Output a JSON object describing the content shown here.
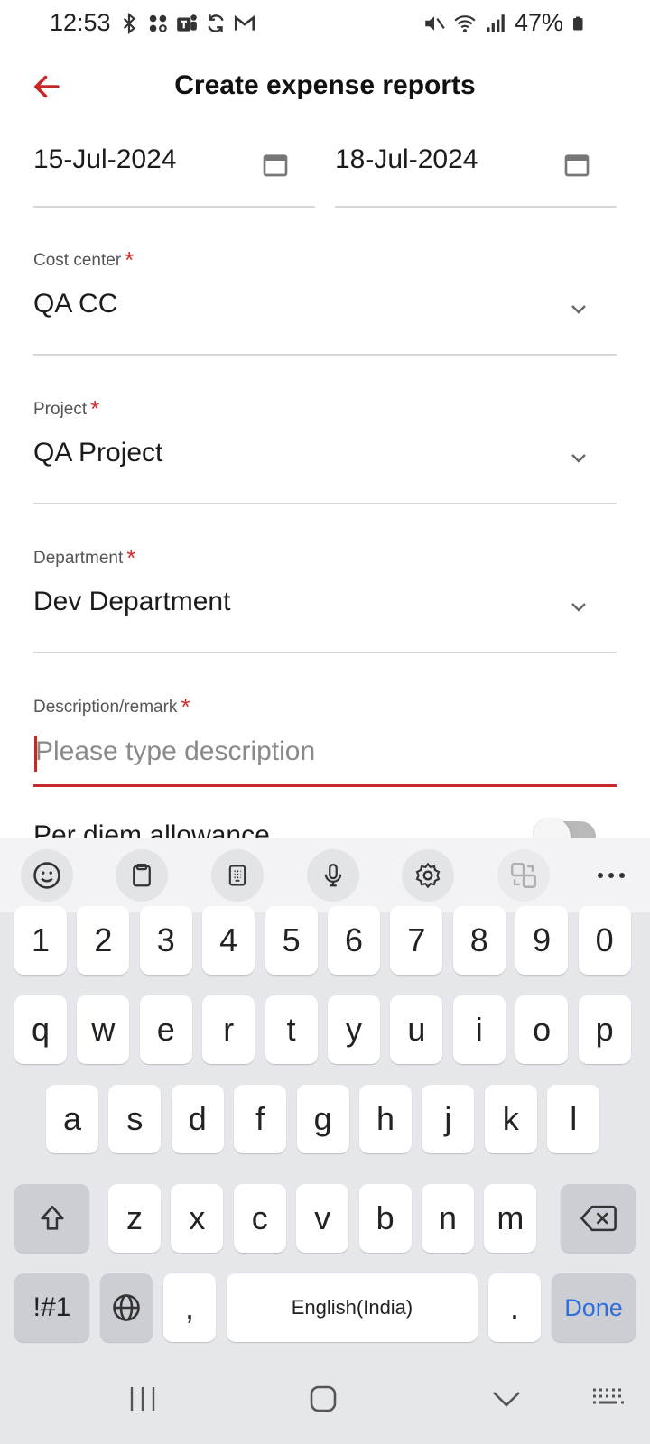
{
  "status_bar": {
    "time": "12:53",
    "battery": "47%",
    "left_icons": [
      "bluetooth-icon",
      "app-grid-icon",
      "teams-icon",
      "sync-icon",
      "gmail-icon"
    ],
    "right_icons": [
      "mute-icon",
      "wifi-icon",
      "signal-icon",
      "battery-icon"
    ]
  },
  "header": {
    "title": "Create expense reports"
  },
  "dates": {
    "start": "15-Jul-2024",
    "end": "18-Jul-2024"
  },
  "form": {
    "cost_center": {
      "label": "Cost center",
      "required": "*",
      "value": "QA CC"
    },
    "project": {
      "label": "Project",
      "required": "*",
      "value": "QA Project"
    },
    "department": {
      "label": "Department",
      "required": "*",
      "value": "Dev Department"
    },
    "description": {
      "label": "Description/remark",
      "required": "*",
      "placeholder": "Please type description",
      "value": ""
    },
    "per_diem": {
      "label": "Per diem allowance",
      "enabled": false
    }
  },
  "keyboard": {
    "toolbar": [
      "emoji-icon",
      "clipboard-icon",
      "keypad-icon",
      "mic-icon",
      "settings-icon",
      "translate-icon",
      "more-icon"
    ],
    "row_numbers": [
      "1",
      "2",
      "3",
      "4",
      "5",
      "6",
      "7",
      "8",
      "9",
      "0"
    ],
    "row1": [
      "q",
      "w",
      "e",
      "r",
      "t",
      "y",
      "u",
      "i",
      "o",
      "p"
    ],
    "row2": [
      "a",
      "s",
      "d",
      "f",
      "g",
      "h",
      "j",
      "k",
      "l"
    ],
    "row3": [
      "z",
      "x",
      "c",
      "v",
      "b",
      "n",
      "m"
    ],
    "symbols_label": "!#1",
    "comma": ",",
    "space_label": "English(India)",
    "period": ".",
    "done_label": "Done"
  },
  "colors": {
    "accent": "#c62828",
    "required": "#d32f2f",
    "done": "#2f6fdb",
    "keyboard_bg": "#e6e7eb"
  }
}
